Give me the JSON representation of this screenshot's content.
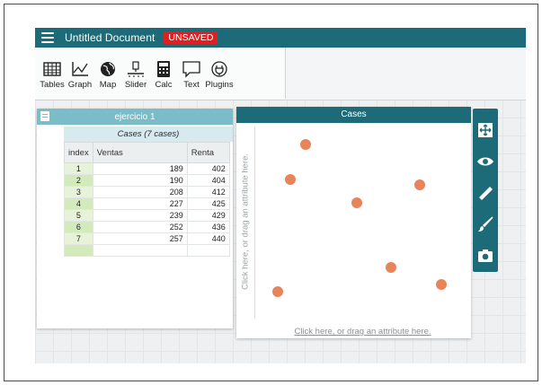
{
  "titlebar": {
    "doc_title": "Untitled Document",
    "unsaved_badge": "UNSAVED"
  },
  "toolbar": {
    "tools": [
      {
        "label": "Tables",
        "icon": "table-icon"
      },
      {
        "label": "Graph",
        "icon": "graph-icon"
      },
      {
        "label": "Map",
        "icon": "globe-icon"
      },
      {
        "label": "Slider",
        "icon": "slider-icon"
      },
      {
        "label": "Calc",
        "icon": "calculator-icon"
      },
      {
        "label": "Text",
        "icon": "speech-bubble-icon"
      },
      {
        "label": "Plugins",
        "icon": "plug-icon"
      }
    ]
  },
  "table_panel": {
    "title": "ejercicio 1",
    "caption": "Cases (7 cases)",
    "columns": [
      "index",
      "Ventas",
      "Renta"
    ],
    "rows": [
      [
        "1",
        "189",
        "402"
      ],
      [
        "2",
        "190",
        "404"
      ],
      [
        "3",
        "208",
        "412"
      ],
      [
        "4",
        "227",
        "425"
      ],
      [
        "5",
        "239",
        "429"
      ],
      [
        "6",
        "252",
        "436"
      ],
      [
        "7",
        "257",
        "440"
      ]
    ]
  },
  "graph_panel": {
    "title": "Cases",
    "y_prompt": "Click here, or drag an attribute here.",
    "x_prompt": "Click here, or drag an attribute here.",
    "point_color": "#e8845a"
  },
  "side_tools": [
    "rescale-icon",
    "eye-icon",
    "ruler-icon",
    "brush-icon",
    "camera-icon"
  ],
  "colors": {
    "teal": "#1d6b78",
    "light_teal": "#7bbcc8",
    "unsaved": "#e02020"
  }
}
